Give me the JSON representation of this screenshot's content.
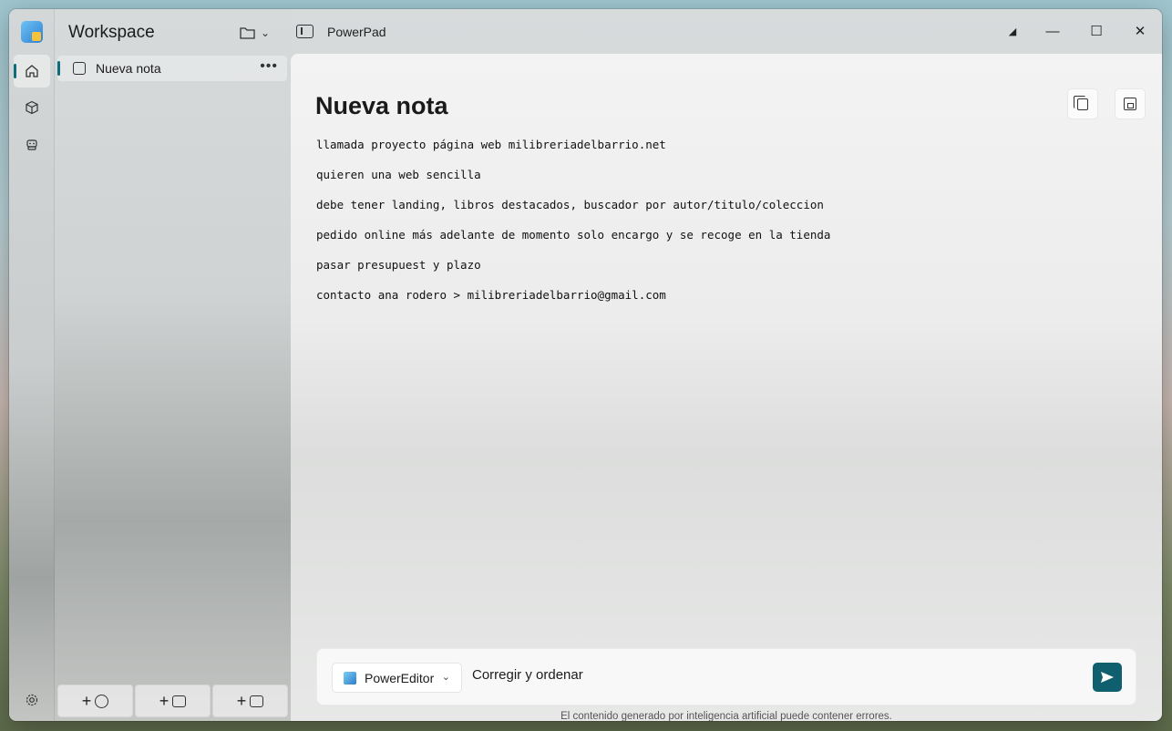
{
  "sidebar": {
    "title": "Workspace",
    "items": [
      {
        "label": "Nueva nota"
      }
    ],
    "more_label": "•••"
  },
  "titlebar": {
    "app_name": "PowerPad"
  },
  "editor": {
    "title": "Nueva nota",
    "lines": [
      "llamada proyecto página web milibreriadelbarrio.net",
      "quieren una web sencilla",
      "debe tener landing, libros destacados, buscador por autor/titulo/coleccion",
      "pedido online más adelante de momento solo encargo y se recoge en la tienda",
      "pasar presupuest y plazo",
      "contacto ana rodero > milibreriadelbarrio@gmail.com"
    ]
  },
  "prompt": {
    "agent": "PowerEditor",
    "text": "Corregir y ordenar",
    "disclaimer": "El contenido generado por inteligencia artificial puede contener errores."
  },
  "icons": {
    "home": "home-icon",
    "box": "box-icon",
    "bot": "bot-icon",
    "settings": "gear-icon"
  },
  "colors": {
    "accent": "#0f6c7d",
    "send": "#0f5f6e"
  }
}
